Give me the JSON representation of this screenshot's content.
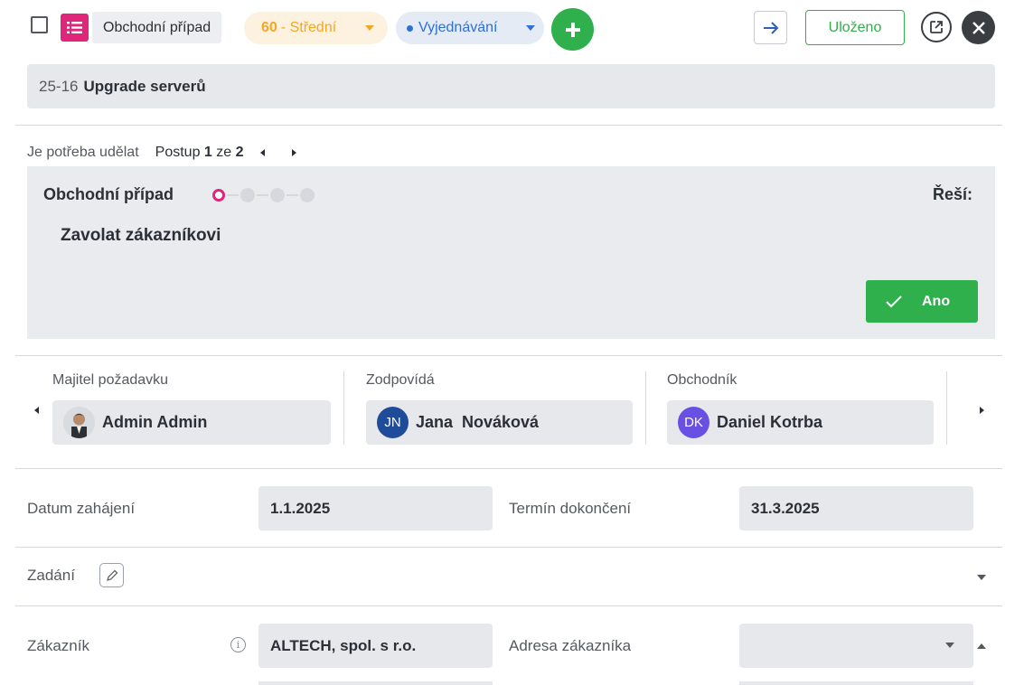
{
  "header": {
    "record_type": "Obchodní případ",
    "priority_value": "60",
    "priority_label": "- Střední",
    "stage_label": "Vyjednávání",
    "saved_label": "Uloženo"
  },
  "record": {
    "number": "25-16",
    "name": "Upgrade serverů"
  },
  "todo": {
    "heading": "Je potřeba udělat",
    "step_prefix": "Postup",
    "step_current": "1",
    "step_sep": "ze",
    "step_total": "2",
    "process_title": "Obchodní případ",
    "resolver_label": "Řeší:",
    "task": "Zavolat zákazníkovi",
    "confirm_label": "Ano",
    "progress_steps": 4,
    "progress_active": 1
  },
  "people": [
    {
      "label": "Majitel požadavku",
      "name": "Admin Admin",
      "initials": "",
      "avatar_color": "#cfd3d8"
    },
    {
      "label": "Zodpovídá",
      "name": "Jana  Nováková",
      "initials": "JN",
      "avatar_color": "#1f4c9a"
    },
    {
      "label": "Obchodník",
      "name": "Daniel Kotrba",
      "initials": "DK",
      "avatar_color": "#6a4fe3"
    }
  ],
  "fields": {
    "start_label": "Datum zahájení",
    "start_value": "1.1.2025",
    "end_label": "Termín dokončení",
    "end_value": "31.3.2025",
    "assignment_label": "Zadání",
    "customer_label": "Zákazník",
    "customer_value": "ALTECH, spol. s r.o.",
    "address_label": "Adresa zákazníka",
    "address_value": ""
  },
  "colors": {
    "accent_green": "#2fb04c",
    "accent_pink": "#e0267a",
    "priority_orange": "#f5a623",
    "stage_blue": "#2f6fd6"
  }
}
